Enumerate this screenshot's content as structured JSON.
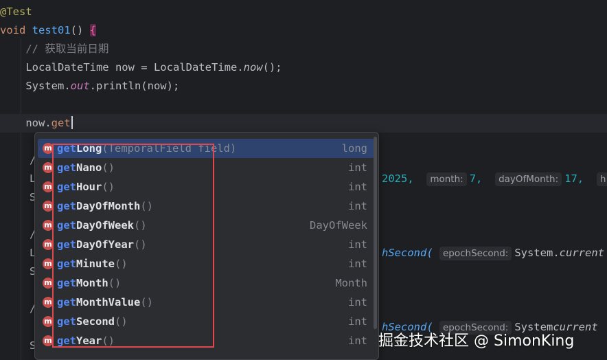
{
  "code": {
    "annotation": "@Test",
    "method_keyword": "void",
    "method_name": "test01",
    "method_parens": "() ",
    "open_brace": "{",
    "comment": "// 获取当前日期",
    "line4_type": "LocalDateTime now = LocalDateTime.",
    "line4_call": "now",
    "line4_end": "();",
    "line5_start": "System.",
    "line5_field": "out",
    "line5_end": ".println(now);",
    "line7_text": "now.",
    "line7_typed": "get",
    "partial_lines": [
      "/",
      "L",
      "S",
      "/",
      "L",
      "S",
      "/",
      "S"
    ],
    "hint_row1": {
      "year_value": "2025,",
      "month_label": "month:",
      "month_value": "7,",
      "day_label": "dayOfMonth:",
      "day_value": "17,",
      "next_label": "h"
    },
    "hint_row2": {
      "method_tail": "hSecond(",
      "param_label": "epochSecond:",
      "arg": "System.",
      "arg_ital": "current"
    },
    "hint_row3": {
      "method_tail": "hSecond(",
      "param_label": "epochSecond:",
      "arg": "System",
      "arg_ital": "current"
    }
  },
  "completion": {
    "typed_prefix": "get",
    "icon_letter": "m",
    "items": [
      {
        "rest": "Long",
        "params": "(TemporalField field)",
        "type": "long"
      },
      {
        "rest": "Nano",
        "params": "()",
        "type": "int"
      },
      {
        "rest": "Hour",
        "params": "()",
        "type": "int"
      },
      {
        "rest": "DayOfMonth",
        "params": "()",
        "type": "int"
      },
      {
        "rest": "DayOfWeek",
        "params": "()",
        "type": "DayOfWeek"
      },
      {
        "rest": "DayOfYear",
        "params": "()",
        "type": "int"
      },
      {
        "rest": "Minute",
        "params": "()",
        "type": "int"
      },
      {
        "rest": "Month",
        "params": "()",
        "type": "Month"
      },
      {
        "rest": "MonthValue",
        "params": "()",
        "type": "int"
      },
      {
        "rest": "Second",
        "params": "()",
        "type": "int"
      },
      {
        "rest": "Year",
        "params": "()",
        "type": "int"
      }
    ]
  },
  "watermark": "掘金技术社区 @ SimonKing",
  "colors": {
    "background": "#1e1f22",
    "popup_bg": "#2b2d30",
    "selection": "#2e436e",
    "highlight_box": "#e0484e",
    "method_icon": "#c94f4f",
    "prefix": "#548af7"
  }
}
